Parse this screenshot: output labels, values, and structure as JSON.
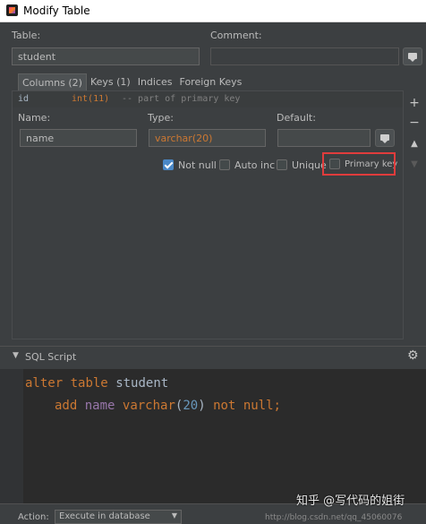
{
  "window": {
    "title": "Modify Table"
  },
  "form": {
    "table_label": "Table:",
    "table_value": "student",
    "comment_label": "Comment:",
    "comment_value": ""
  },
  "tabs": [
    {
      "label": "Columns (2)",
      "active": true
    },
    {
      "label": "Keys (1)",
      "active": false
    },
    {
      "label": "Indices",
      "active": false
    },
    {
      "label": "Foreign Keys",
      "active": false
    }
  ],
  "columns_list": {
    "row_name": "id",
    "row_type": "int(11)",
    "row_comment": "-- part of primary key"
  },
  "column_editor": {
    "name_label": "Name:",
    "name_value": "name",
    "type_label": "Type:",
    "type_value": "varchar(20)",
    "default_label": "Default:",
    "default_value": ""
  },
  "options": {
    "not_null": {
      "label": "Not null",
      "checked": true
    },
    "auto_inc": {
      "label": "Auto inc",
      "checked": false
    },
    "unique": {
      "label": "Unique",
      "checked": false
    },
    "primary_key": {
      "label": "Primary key",
      "checked": false
    }
  },
  "side_buttons": [
    "+",
    "−",
    "▲",
    "▼"
  ],
  "sql": {
    "header": "SQL Script",
    "line1": {
      "kw1": "alter",
      "kw2": "table",
      "name": "student"
    },
    "line2": {
      "kw_add": "add",
      "col": "name",
      "type": "varchar",
      "lp": "(",
      "num": "20",
      "rp": ")",
      "kw_not": "not",
      "kw_null": "null",
      "semi": ";"
    }
  },
  "footer": {
    "action_label": "Action:",
    "action_value": "Execute in database",
    "truncated_text": "http://blog.csdn.net/qq_45060076"
  },
  "watermark": "知乎 @写代码的姐街",
  "colors": {
    "accent": "#4a88c7",
    "highlight": "#e03c3c",
    "keyword": "#cc7832"
  }
}
